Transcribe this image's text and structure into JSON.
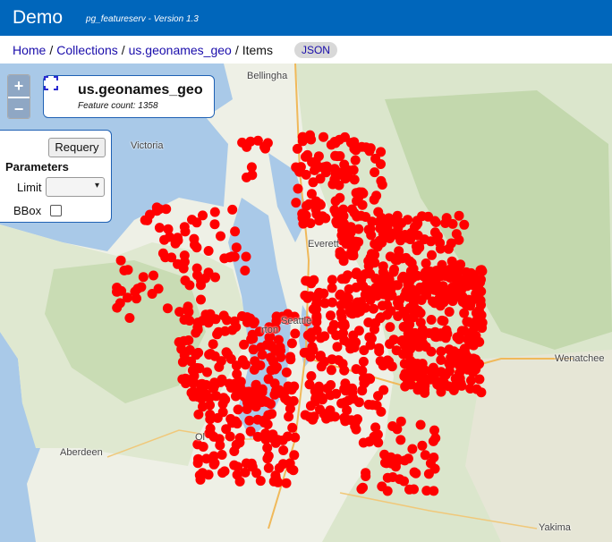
{
  "header": {
    "title": "Demo",
    "subtitle": "pg_featureserv - Version 1.3"
  },
  "breadcrumb": {
    "home": "Home",
    "collections": "Collections",
    "collection": "us.geonames_geo",
    "items": "Items",
    "json": "JSON"
  },
  "map": {
    "layer_title": "us.geonames_geo",
    "feature_count": "Feature count: 1358",
    "zoom_in": "+",
    "zoom_out": "−",
    "places": {
      "bellingham": "Bellingha",
      "victoria": "Victoria",
      "everett": "Everett",
      "seattle": "Seattle",
      "renton": "rton",
      "wenatchee": "Wenatchee",
      "aberdeen": "Aberdeen",
      "yakima": "Yakima",
      "olympia": "Ol"
    },
    "point_color": "#ff0000"
  },
  "params": {
    "requery": "Requery",
    "heading": "Parameters",
    "limit_label": "Limit",
    "limit_value": "",
    "bbox_label": "BBox",
    "bbox_checked": false
  }
}
